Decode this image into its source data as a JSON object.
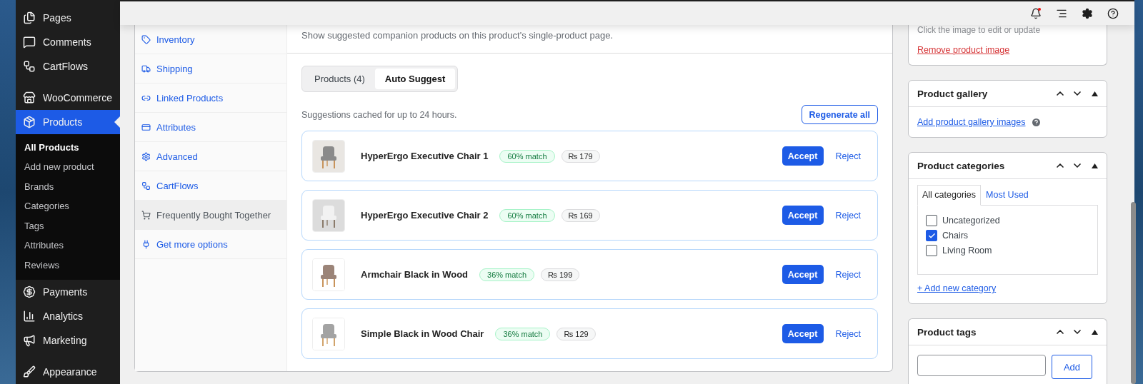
{
  "sidebar": {
    "items": [
      {
        "label": "Pages",
        "selected": false
      },
      {
        "label": "Comments",
        "selected": false
      },
      {
        "label": "CartFlows",
        "selected": false
      },
      {
        "label": "WooCommerce",
        "selected": false
      },
      {
        "label": "Products",
        "selected": true,
        "children": [
          {
            "label": "All Products",
            "selected": true
          },
          {
            "label": "Add new product",
            "selected": false
          },
          {
            "label": "Brands",
            "selected": false
          },
          {
            "label": "Categories",
            "selected": false
          },
          {
            "label": "Tags",
            "selected": false
          },
          {
            "label": "Attributes",
            "selected": false
          },
          {
            "label": "Reviews",
            "selected": false
          }
        ]
      },
      {
        "label": "Payments",
        "selected": false
      },
      {
        "label": "Analytics",
        "selected": false
      },
      {
        "label": "Marketing",
        "selected": false
      },
      {
        "label": "Appearance",
        "selected": false
      }
    ]
  },
  "product_data": {
    "tabs": [
      {
        "label": "Inventory",
        "selected": false
      },
      {
        "label": "Shipping",
        "selected": false
      },
      {
        "label": "Linked Products",
        "selected": false
      },
      {
        "label": "Attributes",
        "selected": false
      },
      {
        "label": "Advanced",
        "selected": false
      },
      {
        "label": "CartFlows",
        "selected": false
      },
      {
        "label": "Frequently Bought Together",
        "selected": true
      },
      {
        "label": "Get more options",
        "selected": false
      }
    ],
    "description": "Show suggested companion products on this product's single-product page.",
    "mode_tabs": [
      {
        "label": "Products (4)",
        "selected": false
      },
      {
        "label": "Auto Suggest",
        "selected": true
      }
    ],
    "cache_note": "Suggestions cached for up to 24 hours.",
    "regenerate_button": "Regenerate all",
    "suggestions": [
      {
        "name": "HyperErgo Executive Chair 1",
        "match": "60% match",
        "price": "₨ 179",
        "accept": "Accept",
        "reject": "Reject"
      },
      {
        "name": "HyperErgo Executive Chair 2",
        "match": "60% match",
        "price": "₨ 169",
        "accept": "Accept",
        "reject": "Reject"
      },
      {
        "name": "Armchair Black in Wood",
        "match": "36% match",
        "price": "₨ 199",
        "accept": "Accept",
        "reject": "Reject"
      },
      {
        "name": "Simple Black in Wood Chair",
        "match": "36% match",
        "price": "₨ 129",
        "accept": "Accept",
        "reject": "Reject"
      }
    ]
  },
  "product_image": {
    "hint": "Click the image to edit or update",
    "remove_link": "Remove product image"
  },
  "product_gallery": {
    "title": "Product gallery",
    "add_link": "Add product gallery images"
  },
  "product_categories": {
    "title": "Product categories",
    "tabs": [
      {
        "label": "All categories",
        "selected": true
      },
      {
        "label": "Most Used",
        "selected": false
      }
    ],
    "items": [
      {
        "label": "Uncategorized",
        "checked": false
      },
      {
        "label": "Chairs",
        "checked": true
      },
      {
        "label": "Living Room",
        "checked": false
      }
    ],
    "add_link": "+ Add new category"
  },
  "product_tags": {
    "title": "Product tags",
    "add_button": "Add"
  }
}
